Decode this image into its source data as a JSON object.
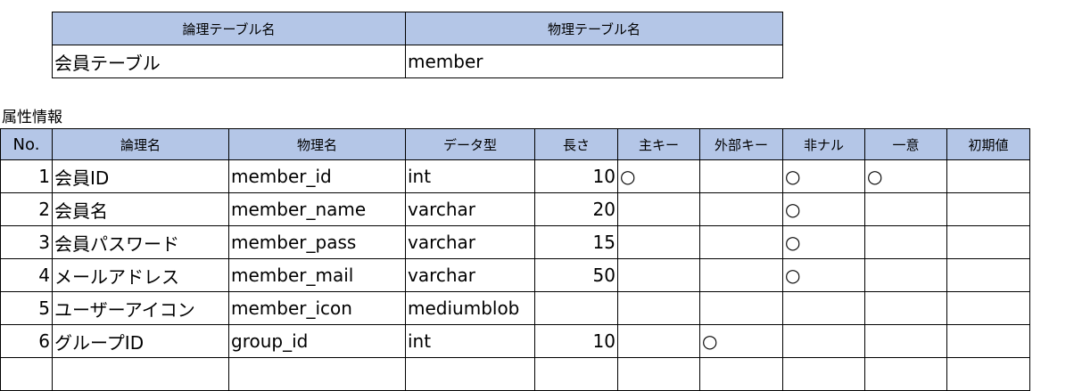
{
  "meta_table": {
    "headers": [
      "論理テーブル名",
      "物理テーブル名"
    ],
    "logical_name": "会員テーブル",
    "physical_name": "member"
  },
  "section_label": "属性情報",
  "attr_table": {
    "headers": [
      "No.",
      "論理名",
      "物理名",
      "データ型",
      "長さ",
      "主キー",
      "外部キー",
      "非ナル",
      "一意",
      "初期値"
    ],
    "rows": [
      [
        "1",
        "会員ID",
        "member_id",
        "int",
        "10",
        "○",
        "",
        "○",
        "○",
        ""
      ],
      [
        "2",
        "会員名",
        "member_name",
        "varchar",
        "20",
        "",
        "",
        "○",
        "",
        ""
      ],
      [
        "3",
        "会員パスワード",
        "member_pass",
        "varchar",
        "15",
        "",
        "",
        "○",
        "",
        ""
      ],
      [
        "4",
        "メールアドレス",
        "member_mail",
        "varchar",
        "50",
        "",
        "",
        "○",
        "",
        ""
      ],
      [
        "5",
        "ユーザーアイコン",
        "member_icon",
        "mediumblob",
        "",
        "",
        "",
        "",
        "",
        ""
      ],
      [
        "6",
        "グループID",
        "group_id",
        "int",
        "10",
        "",
        "○",
        "",
        "",
        ""
      ],
      [
        "",
        "",
        "",
        "",
        "",
        "",
        "",
        "",
        "",
        ""
      ]
    ]
  }
}
